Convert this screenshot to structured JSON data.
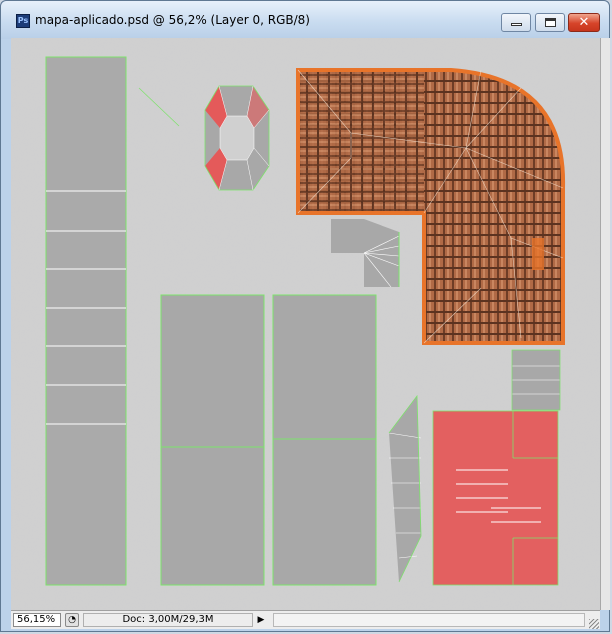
{
  "window": {
    "title": "mapa-aplicado.psd @ 56,2% (Layer 0, RGB/8)",
    "app_icon": "photoshop-icon",
    "app_icon_text": "Ps"
  },
  "controls": {
    "minimize_icon": "minimize-icon",
    "maximize_icon": "maximize-icon",
    "close_icon": "close-icon",
    "close_glyph": "✕"
  },
  "statusbar": {
    "zoom": "56,15%",
    "doc_info": "Doc: 3,00M/29,3M",
    "menu_arrow": "▶"
  },
  "colors": {
    "roof_tile": "#b06a46",
    "roof_edge": "#e8742a",
    "red_selection": "#e45a5a",
    "uv_wireframe": "#7de36b",
    "wall_base": "#a8a8a8"
  }
}
